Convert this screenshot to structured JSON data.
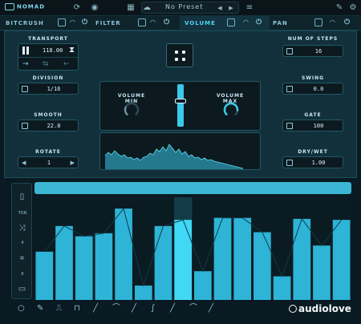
{
  "app": {
    "logo_text": "NOMAD"
  },
  "topbar": {
    "preset_name": "No Preset",
    "prev_icon": "triangle-left",
    "next_icon": "triangle-right"
  },
  "modules": [
    {
      "label": "BITCRUSH",
      "active": false
    },
    {
      "label": "FILTER",
      "active": false
    },
    {
      "label": "VOLUME",
      "active": true
    },
    {
      "label": "PAN",
      "active": false
    }
  ],
  "transport": {
    "label": "TRANSPORT",
    "bpm": "118.00"
  },
  "division": {
    "label": "DIVISION",
    "value": "1/16"
  },
  "smooth": {
    "label": "SMOOTH",
    "value": "22.8"
  },
  "rotate": {
    "label": "ROTATE",
    "value": "1"
  },
  "num_steps": {
    "label": "NUM OF STEPS",
    "value": "16"
  },
  "swing": {
    "label": "SWING",
    "value": "0.0"
  },
  "gate": {
    "label": "GATE",
    "value": "100"
  },
  "dry_wet": {
    "label": "DRY/WET",
    "value": "1.00"
  },
  "volume_min": {
    "label": "VOLUME MIN",
    "level": 0.25
  },
  "volume_max": {
    "label": "VOLUME MAX",
    "level": 0.85
  },
  "sequencer": {
    "side_labels": [
      "TON",
      "4",
      "8"
    ],
    "steps": [
      0.47,
      0.72,
      0.62,
      0.65,
      0.89,
      0.14,
      0.72,
      0.78,
      0.28,
      0.8,
      0.8,
      0.66,
      0.23,
      0.79,
      0.53,
      0.78
    ],
    "active_step": 7,
    "colors": {
      "bar": "#2db4d6",
      "bar_active": "#41d8f6",
      "column_active": "#123c48"
    }
  },
  "watermark": {
    "text": "audiolove"
  },
  "colors": {
    "accent": "#3cc9e8",
    "bg": "#0a1a22",
    "panel": "#12303b"
  }
}
